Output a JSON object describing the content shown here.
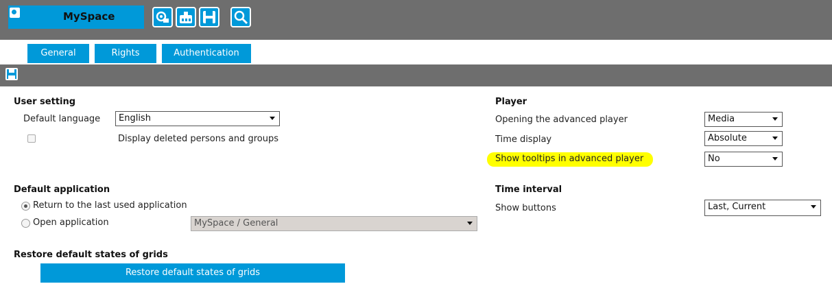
{
  "app": {
    "title": "MySpace",
    "toolbar_icons": [
      "camera-icon",
      "grid-icon",
      "floppy-icon",
      "search-icon"
    ]
  },
  "tabs": [
    {
      "label": "General",
      "active": true
    },
    {
      "label": "Rights",
      "active": false
    },
    {
      "label": "Authentication",
      "active": false
    }
  ],
  "strip": {
    "icon": "save-icon"
  },
  "user_setting": {
    "heading": "User setting",
    "default_language_label": "Default language",
    "default_language_value": "English",
    "display_deleted_label": "Display deleted persons and groups",
    "display_deleted_checked": false
  },
  "default_application": {
    "heading": "Default application",
    "option_last_used": "Return to the last used application",
    "option_open": "Open application",
    "selected": "last_used",
    "open_app_value": "MySpace / General"
  },
  "restore": {
    "heading": "Restore default states of grids",
    "button_label": "Restore default states of grids"
  },
  "player": {
    "heading": "Player",
    "opening_label": "Opening the advanced player",
    "opening_value": "Media",
    "time_display_label": "Time display",
    "time_display_value": "Absolute",
    "tooltips_label": "Show tooltips in advanced player",
    "tooltips_value": "No",
    "highlight_color": "#ffff00"
  },
  "time_interval": {
    "heading": "Time interval",
    "show_buttons_label": "Show buttons",
    "show_buttons_value": "Last, Current"
  },
  "colors": {
    "accent": "#0099d9",
    "bar_grey": "#6e6e6e"
  }
}
